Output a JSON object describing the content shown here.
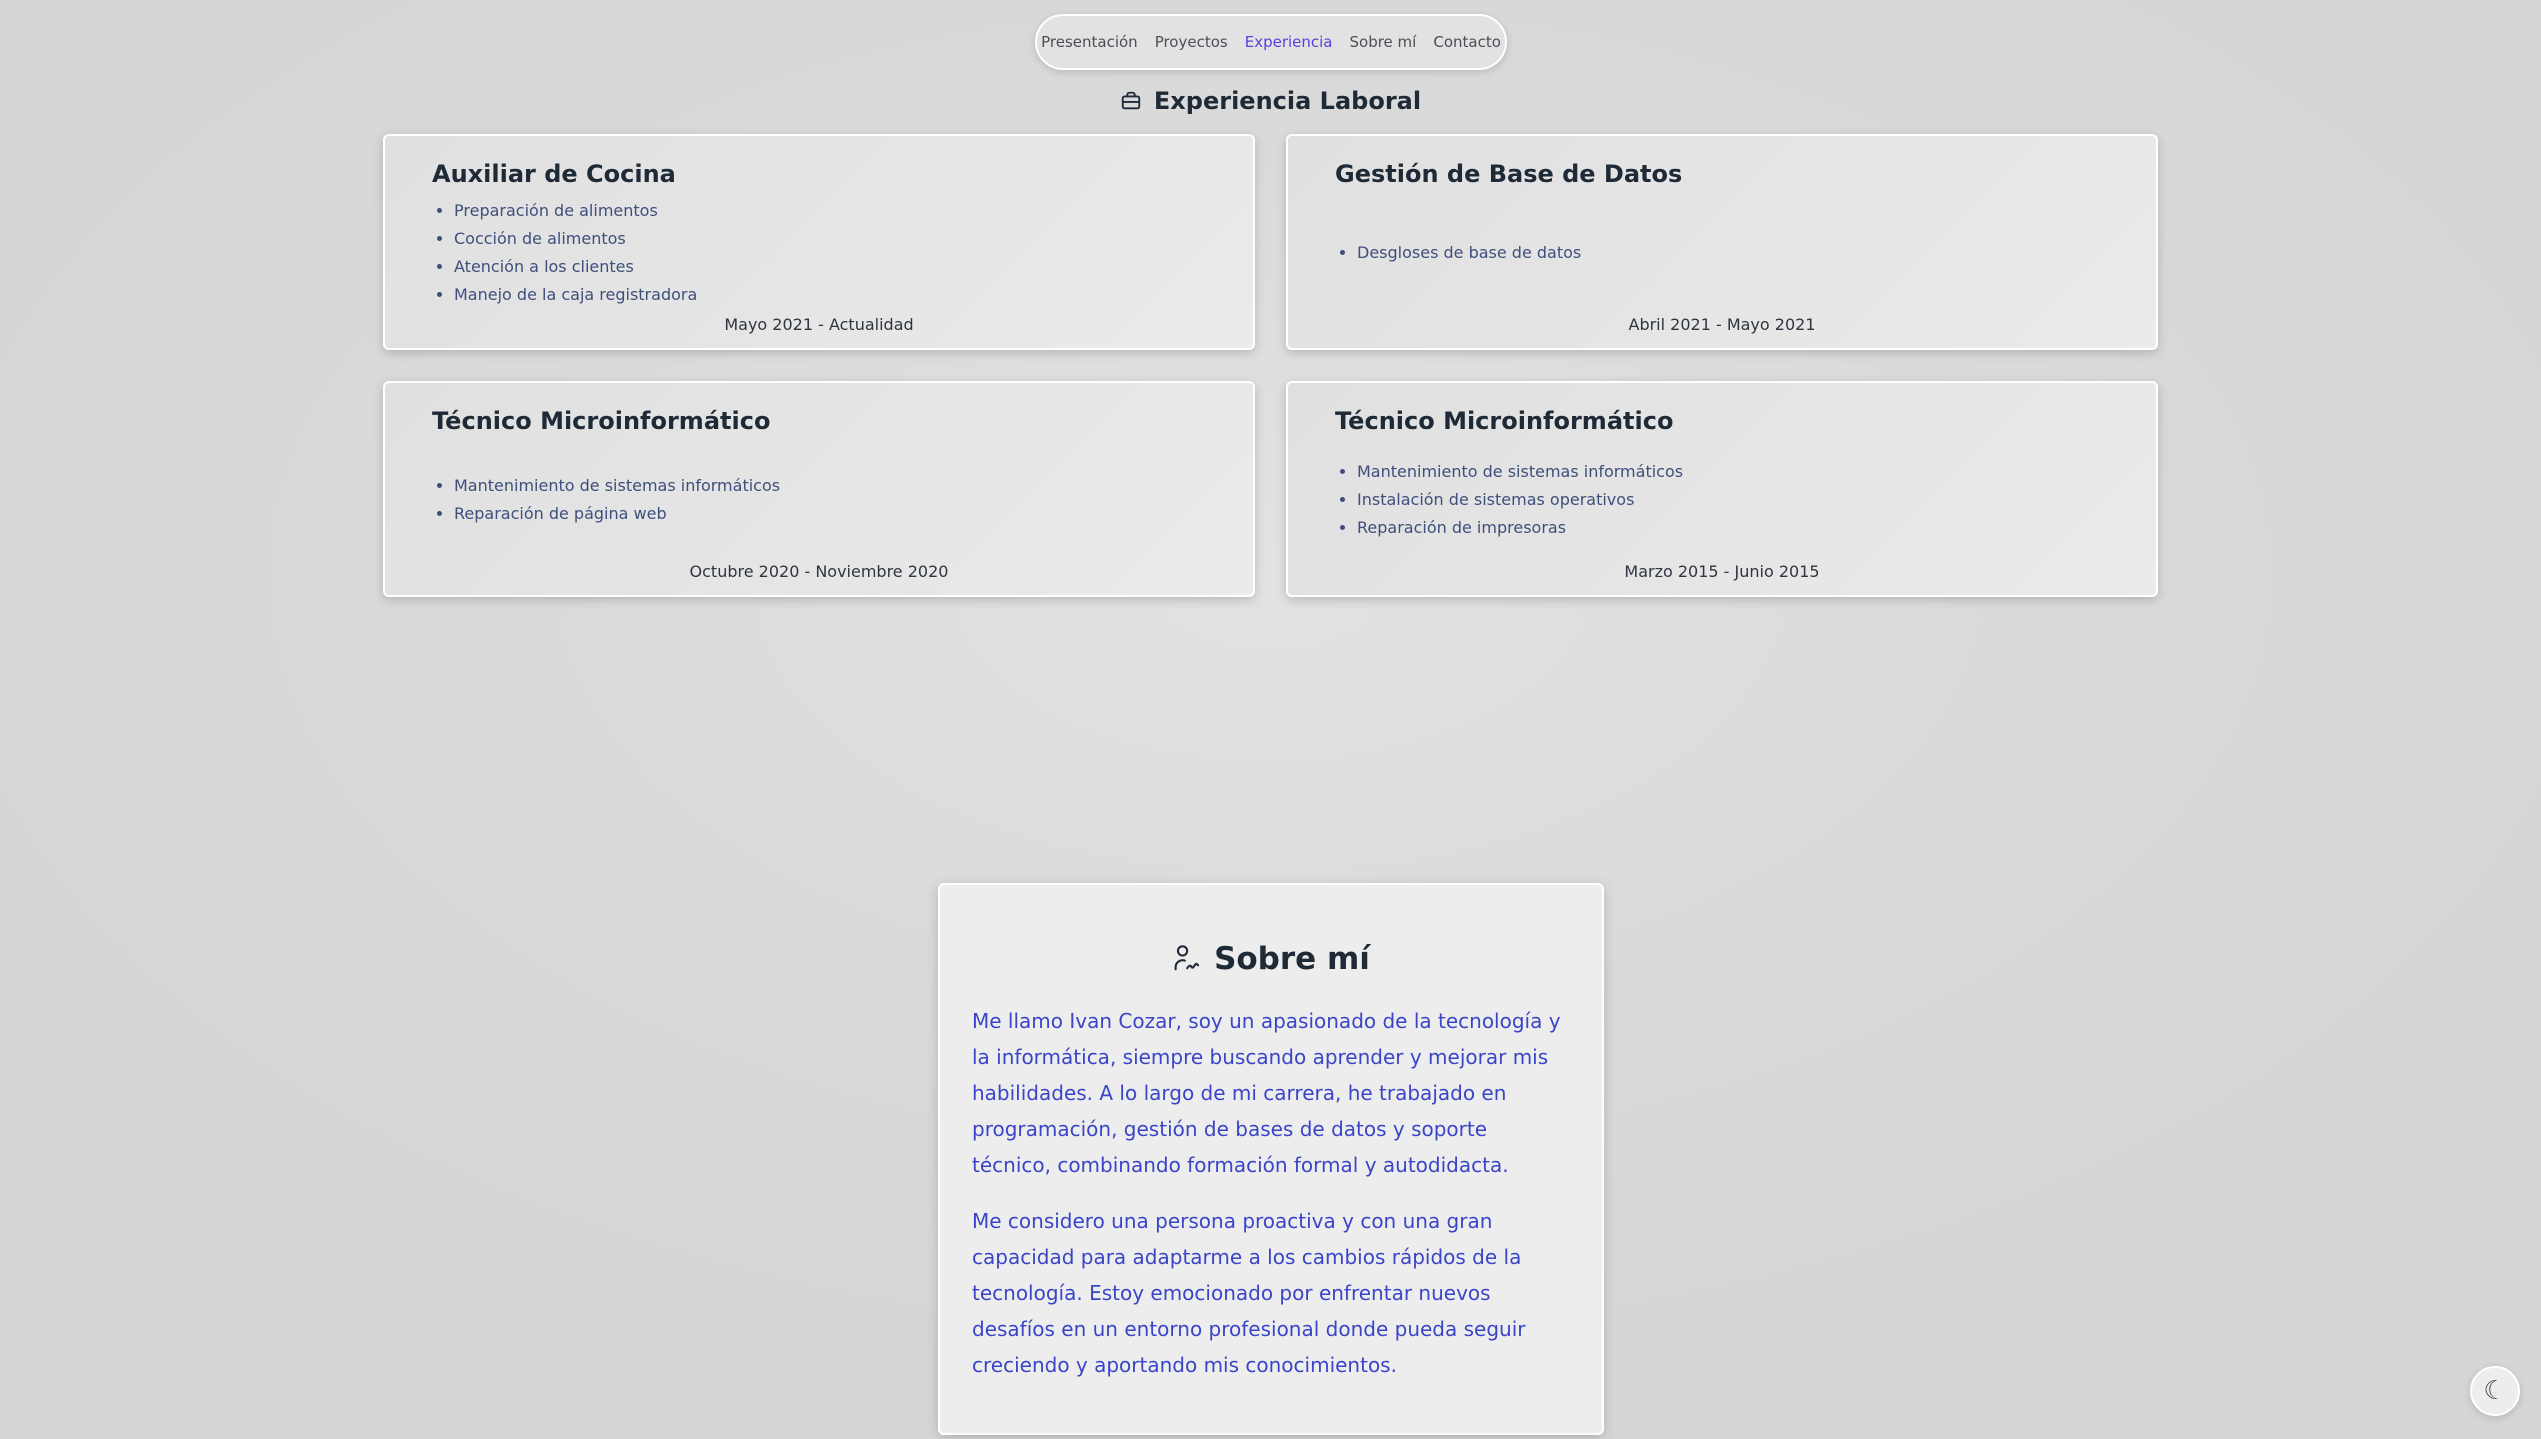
{
  "nav": {
    "items": [
      {
        "label": "Presentación",
        "active": false
      },
      {
        "label": "Proyectos",
        "active": false
      },
      {
        "label": "Experiencia",
        "active": true
      },
      {
        "label": "Sobre mí",
        "active": false
      },
      {
        "label": "Contacto",
        "active": false
      }
    ]
  },
  "experience": {
    "title": "Experiencia Laboral",
    "icon": "briefcase-icon",
    "jobs": [
      {
        "title": "Auxiliar de Cocina",
        "tasks": [
          "Preparación de alimentos",
          "Cocción de alimentos",
          "Atención a los clientes",
          "Manejo de la caja registradora"
        ],
        "dates": "Mayo 2021 - Actualidad"
      },
      {
        "title": "Gestión de Base de Datos",
        "tasks": [
          "Desgloses de base de datos"
        ],
        "dates": "Abril 2021 - Mayo 2021"
      },
      {
        "title": "Técnico Microinformático",
        "tasks": [
          "Mantenimiento de sistemas informáticos",
          "Reparación de página web"
        ],
        "dates": "Octubre 2020 - Noviembre 2020"
      },
      {
        "title": "Técnico Microinformático",
        "tasks": [
          "Mantenimiento de sistemas informáticos",
          "Instalación de sistemas operativos",
          "Reparación de impresoras"
        ],
        "dates": "Marzo 2015 - Junio 2015"
      }
    ]
  },
  "about": {
    "title": "Sobre mí",
    "icon": "user-signature-icon",
    "paragraphs": [
      "Me llamo Ivan Cozar, soy un apasionado de la tecnología y la informática, siempre buscando aprender y mejorar mis habilidades. A lo largo de mi carrera, he trabajado en programación, gestión de bases de datos y soporte técnico, combinando formación formal y autodidacta.",
      "Me considero una persona proactiva y con una gran capacidad para adaptarme a los cambios rápidos de la tecnología. Estoy emocionado por enfrentar nuevos desafíos en un entorno profesional donde pueda seguir creciendo y aportando mis conocimientos."
    ]
  },
  "theme_toggle": {
    "icon": "moon-icon",
    "glyph": "☾"
  },
  "colors": {
    "accent": "#5a3fdc",
    "about_text": "#3a45c8",
    "heading": "#1f2a37",
    "list_text": "#3f4f7c"
  }
}
